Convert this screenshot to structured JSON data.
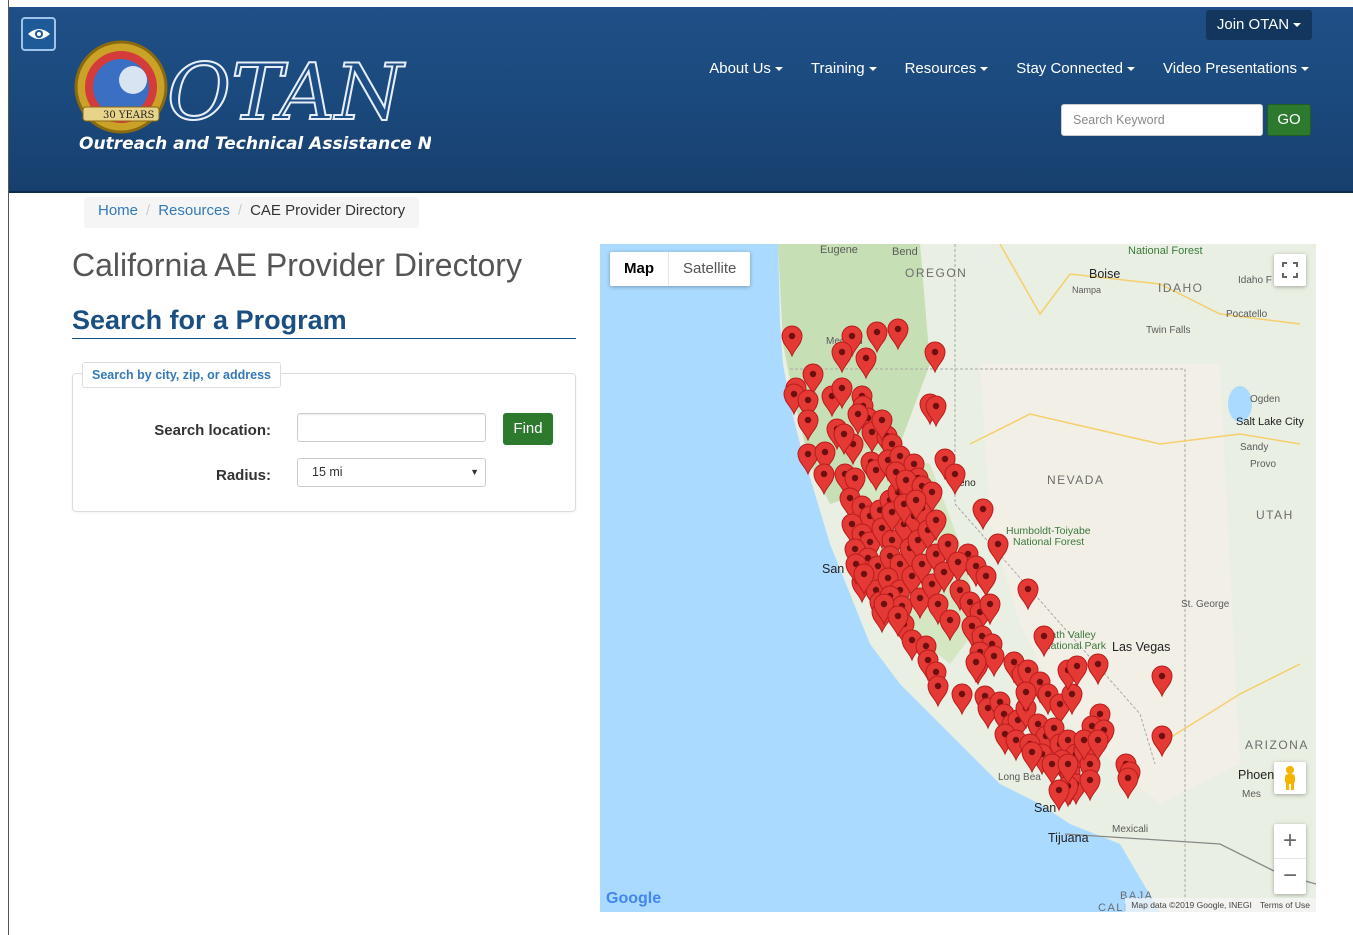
{
  "header": {
    "logo_top_text": "OTAN",
    "logo_tagline": "Outreach and Technical Assistance Network",
    "logo_badge": "30 YEARS",
    "join_label": "Join OTAN",
    "nav": [
      "About Us",
      "Training",
      "Resources",
      "Stay Connected",
      "Video Presentations"
    ],
    "search_placeholder": "Search Keyword",
    "go_label": "GO",
    "brand_color": "#1b4a7e",
    "go_color": "#2d7a2f"
  },
  "breadcrumb": {
    "home": "Home",
    "resources": "Resources",
    "current": "CAE Provider Directory"
  },
  "main": {
    "page_title": "California AE Provider Directory",
    "section_title": "Search for a Program",
    "fieldset_legend": "Search by city, zip, or address",
    "location_label": "Search location:",
    "location_value": "",
    "find_label": "Find",
    "radius_label": "Radius:",
    "radius_value": "15 mi"
  },
  "map": {
    "tab_map": "Map",
    "tab_satellite": "Satellite",
    "zoom_in": "+",
    "zoom_out": "−",
    "google_logo": "Google",
    "attribution": "Map data ©2019 Google, INEGI",
    "terms": "Terms of Use",
    "labels": {
      "eugene": "Eugene",
      "bend": "Bend",
      "oregon": "OREGON",
      "national_forest": "National Forest",
      "boise": "Boise",
      "nampa": "Nampa",
      "idaho": "IDAHO",
      "idaho_f": "Idaho F",
      "pocatello": "Pocatello",
      "twin_falls": "Twin Falls",
      "medford": "Medford",
      "ogden": "Ogden",
      "salt_lake_city": "Salt Lake City",
      "sandy": "Sandy",
      "provo": "Provo",
      "nevada": "NEVADA",
      "utah": "UTAH",
      "reno": "eno",
      "humboldt": "Humboldt-Toiyabe",
      "humboldt2": "National Forest",
      "san_f": "San F",
      "st_george": "St. George",
      "death_valley": "Death Valley",
      "death_valley2": "National Park",
      "las_vegas": "Las Vegas",
      "arizona": "ARIZONA",
      "phoenix": "Phoen",
      "mesa": "Mes",
      "long_beach": "Long Bea",
      "san_diego": "San",
      "tijuana": "Tijuana",
      "mexicali": "Mexicali",
      "baja": "BAJA",
      "cali": "CALI"
    },
    "pin_color": "#e53935"
  }
}
